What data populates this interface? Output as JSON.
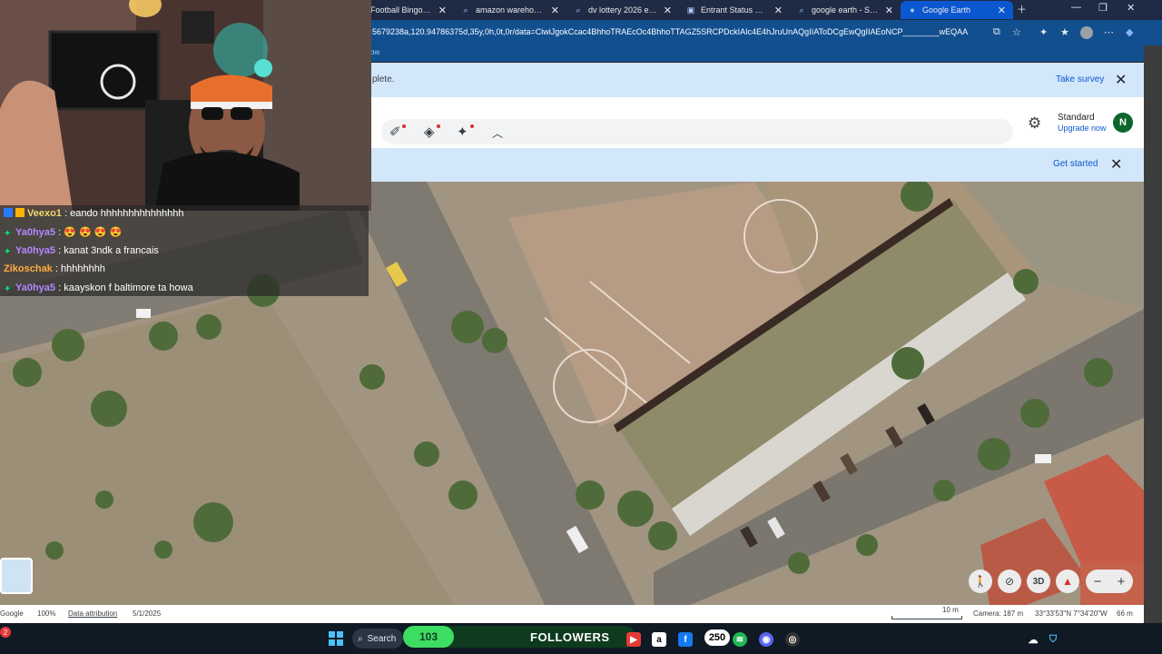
{
  "browser": {
    "tabs": [
      {
        "label": "Football Bingo Daily - F",
        "icon": "game-icon"
      },
      {
        "label": "amazon warehouse bu",
        "icon": "search-icon"
      },
      {
        "label": "dv lottery 2026 enrollm",
        "icon": "search-icon"
      },
      {
        "label": "Entrant Status Check W",
        "icon": "page-icon"
      },
      {
        "label": "google earth - Search",
        "icon": "search-icon"
      },
      {
        "label": "Google Earth",
        "icon": "google-earth-icon",
        "active": true
      }
    ],
    "url": "5679238a,120.94786375d,35y,0h,0t,0r/data=CiwiJgokCcac4BhhoTRAEcOc4BhhoTTAGZ5SRCPDckIAIc4E4hJruUnAQgIIAToDCgEwQgIIAEoNCP________wEQAA",
    "bookmark_text": "ow"
  },
  "earth": {
    "survey_message": "plete.",
    "survey_link": "Take survey",
    "plan_name": "Standard",
    "upgrade_link": "Upgrade now",
    "avatar_letter": "N",
    "get_started": "Get started",
    "status": {
      "brand": "Google",
      "zoom": "100%",
      "attribution": "Data attribution",
      "date": "5/1/2025",
      "scale": "10 m",
      "camera": "Camera: 187 m",
      "coords": "33°33'53\"N 7°34'20\"W",
      "elevation": "66 m"
    },
    "controls": {
      "three_d": "3D",
      "zoom_in": "+",
      "zoom_out": "−"
    }
  },
  "chat": [
    {
      "user": "Veexo1",
      "message": ": eando hhhhhhhhhhhhhhh",
      "color": "#f5d76e"
    },
    {
      "user": "Ya0hya5",
      "message": ": 😍 😍 😍 😍",
      "color": "#b388ff"
    },
    {
      "user": "Ya0hya5",
      "message": ": kanat 3ndk a francais",
      "color": "#b388ff"
    },
    {
      "user": "Zikoschak",
      "message": ": hhhhhhhh",
      "color": "#ffab40"
    },
    {
      "user": "Ya0hya5",
      "message": ": kaayskon f baltimore ta howa",
      "color": "#b388ff"
    }
  ],
  "taskbar": {
    "search_label": "Search",
    "followers_count": "103",
    "followers_label": "FOLLOWERS",
    "badge_count": "250",
    "notification_count": "2"
  }
}
